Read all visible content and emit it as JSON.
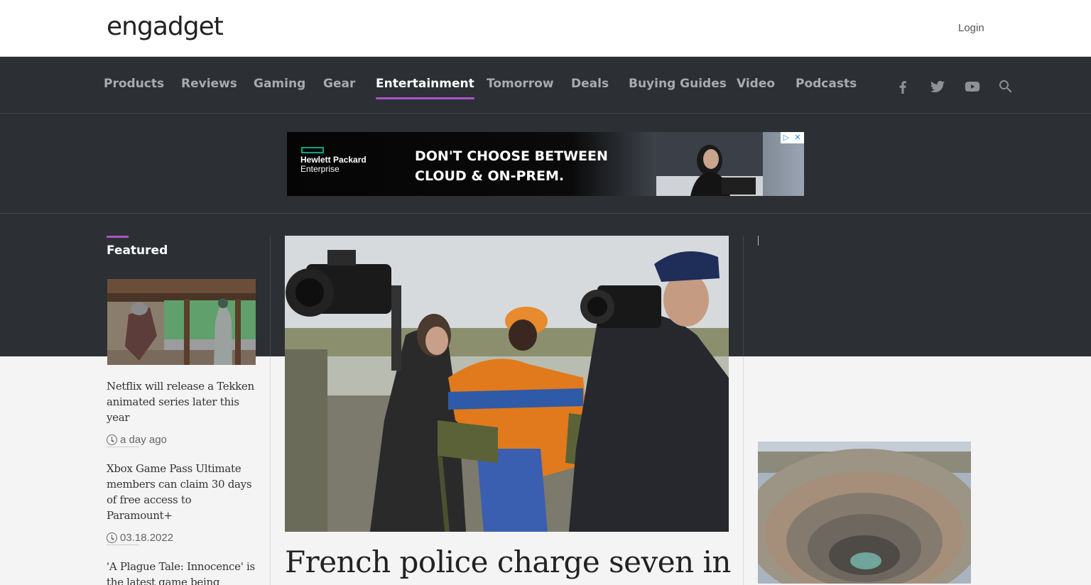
{
  "header": {
    "logo": "engadget",
    "login_label": "Login"
  },
  "nav": {
    "items": [
      {
        "label": "Products"
      },
      {
        "label": "Reviews"
      },
      {
        "label": "Gaming"
      },
      {
        "label": "Gear"
      },
      {
        "label": "Entertainment",
        "active": true
      },
      {
        "label": "Tomorrow"
      },
      {
        "label": "Deals"
      },
      {
        "label": "Buying Guides"
      },
      {
        "label": "Video"
      },
      {
        "label": "Podcasts"
      }
    ],
    "icons": [
      "facebook-icon",
      "twitter-icon",
      "youtube-icon",
      "search-icon"
    ]
  },
  "ad": {
    "brand_line1": "Hewlett Packard",
    "brand_line2": "Enterprise",
    "headline": "DON'T CHOOSE BETWEEN CLOUD & ON-PREM.",
    "adchoices_play": "▷",
    "adchoices_close": "✕"
  },
  "featured": {
    "title": "Featured",
    "stories": [
      {
        "title": "Netflix will release a Tekken animated series later this year",
        "time": "a day ago"
      },
      {
        "title": "Xbox Game Pass Ultimate members can claim 30 days of free access to Paramount+",
        "time": "03.18.2022"
      },
      {
        "title": "'A Plague Tale: Innocence' is the latest game being adapted"
      }
    ]
  },
  "main": {
    "headline": "French police charge seven in"
  },
  "colors": {
    "accent": "#a855c9",
    "nav_bg": "#2c2f33",
    "page_bg": "#f4f4f5"
  }
}
